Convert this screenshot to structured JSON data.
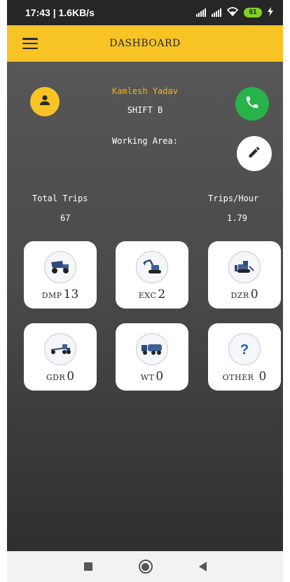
{
  "status_bar": {
    "time_speed": "17:43 | 1.6KB/s",
    "battery": "61",
    "icons": [
      "signal-icon",
      "signal-icon",
      "wifi-icon",
      "battery-icon",
      "charging-icon"
    ]
  },
  "app_bar": {
    "title": "DASHBOARD",
    "menu_icon": "hamburger-menu-icon"
  },
  "colors": {
    "accent": "#f7c325",
    "call_green": "#27b24a",
    "name_text": "#f2b51b"
  },
  "profile": {
    "name": "Kamlesh Yadav",
    "shift": "SHIFT B",
    "working_area_label": "Working Area:",
    "avatar_icon": "person-icon",
    "call_icon": "phone-icon",
    "edit_icon": "pencil-icon"
  },
  "stats": {
    "total_trips_label": "Total Trips",
    "total_trips_value": "67",
    "trips_hour_label": "Trips/Hour",
    "trips_hour_value": "1.79"
  },
  "equipment": [
    {
      "code": "DMP",
      "count": "13",
      "icon": "dump-truck-icon"
    },
    {
      "code": "EXC",
      "count": "2",
      "icon": "excavator-icon"
    },
    {
      "code": "DZR",
      "count": "0",
      "icon": "dozer-icon"
    },
    {
      "code": "GDR",
      "count": "0",
      "icon": "grader-icon"
    },
    {
      "code": "WT",
      "count": "0",
      "icon": "water-tanker-icon"
    },
    {
      "code": "OTHER",
      "count": "0",
      "icon": "question-mark-icon"
    }
  ],
  "nav_bar": {
    "icons": [
      "recents-square-icon",
      "home-circle-icon",
      "back-triangle-icon"
    ]
  }
}
